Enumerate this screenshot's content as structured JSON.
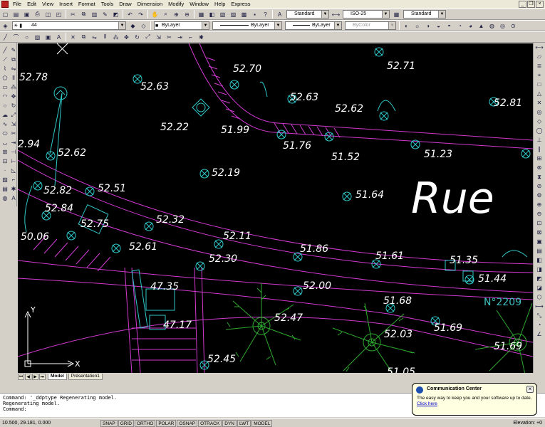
{
  "menubar": {
    "items": [
      "File",
      "Edit",
      "View",
      "Insert",
      "Format",
      "Tools",
      "Draw",
      "Dimension",
      "Modify",
      "Window",
      "Help",
      "Express"
    ]
  },
  "toolbar_styles": {
    "text_style": "Standard",
    "dim_style": "ISO-25",
    "table_style": "Standard"
  },
  "toolbar_layers": {
    "layer_name": "44",
    "color": "ByLayer",
    "linetype": "ByLayer",
    "lineweight": "ByLayer",
    "plotstyle": "ByColor"
  },
  "drawing": {
    "elevations": [
      "52.78",
      "52.63",
      "52.70",
      "52.71",
      "52.63",
      "52.62",
      "52.81",
      "52.22",
      "51.99",
      "51.76",
      "51.52",
      "51.23",
      "2.94",
      "52.62",
      "52.19",
      "51.64",
      "52.82",
      "52.51",
      "52.84",
      "52.32",
      "52.75",
      "50.06",
      "52.11",
      "52.61",
      "51.86",
      "51.61",
      "51.35",
      "52.30",
      "51.44",
      "47.35",
      "52.00",
      "51.68",
      "47.17",
      "52.47",
      "52.03",
      "51.69",
      "51.69",
      "52.45",
      "51.05"
    ],
    "street_label": "Rue",
    "parcel_label": "N°2209",
    "ucs_x": "X",
    "ucs_y": "Y"
  },
  "tabs": {
    "items": [
      "Model",
      "Présentation1"
    ]
  },
  "command": {
    "lines": [
      "Command: '_ddptype Regenerating model.",
      "Regenerating model.",
      "Command:"
    ]
  },
  "status": {
    "coords": "10.500, 29.181, 0.000",
    "buttons": [
      "SNAP",
      "GRID",
      "ORTHO",
      "POLAR",
      "OSNAP",
      "OTRACK",
      "DYN",
      "LWT",
      "MODEL"
    ],
    "elevation": "Elevation: +0"
  },
  "comm_center": {
    "title": "Communication Center",
    "message": "The easy way to keep you and your software up to date.",
    "link": "Click here"
  },
  "colors": {
    "canvas": "#000000",
    "road_lines": "#d23ad2",
    "points": "#31c9c9",
    "trees": "#2faa2f",
    "parcel_text": "#3fc0c0"
  }
}
